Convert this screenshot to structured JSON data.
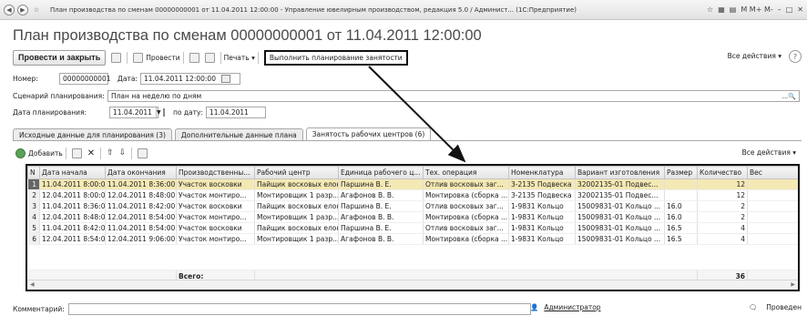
{
  "window": {
    "title": "План производства по сменам 00000000001 от 11.04.2011 12:00:00 - Управление ювелирным производством, редакция 5.0 / Админист... (1С:Предприятие)",
    "right_icons": "M  M+  M-"
  },
  "document": {
    "title": "План производства по сменам 00000000001 от 11.04.2011 12:00:00"
  },
  "toolbar": {
    "post_close": "Провести и закрыть",
    "post": "Провести",
    "print": "Печать ▾",
    "plan": "Выполнить планирование занятости",
    "all_actions": "Все действия ▾",
    "help": "?"
  },
  "form": {
    "number_label": "Номер:",
    "number_value": "00000000001",
    "date_label": "Дата:",
    "date_value": "11.04.2011 12:00:00",
    "scenario_label": "Сценарий планирования:",
    "scenario_value": "План на неделю по дням",
    "plan_date_label": "Дата планирования:",
    "plan_date_from": "11.04.2011",
    "plan_date_to_label": "по дату:",
    "plan_date_to": "11.04.2011"
  },
  "tabs": [
    {
      "label": "Исходные данные для планирования (3)"
    },
    {
      "label": "Дополнительные данные плана"
    },
    {
      "label": "Занятость рабочих центров (6)"
    }
  ],
  "table_toolbar": {
    "add": "Добавить",
    "all_actions": "Все действия ▾"
  },
  "table": {
    "columns": [
      "N",
      "Дата начала",
      "Дата окончания",
      "Производственны...",
      "Рабочий центр",
      "Единица рабочего ц...",
      "Тех. операция",
      "Номенклатура",
      "Вариант изготовления",
      "Размер",
      "Количество",
      "Вес"
    ],
    "rows": [
      [
        "1",
        "11.04.2011 8:00:00",
        "11.04.2011 8:36:00",
        "Участок восковки",
        "Пайщик восковых елок",
        "Паршина В. Е.",
        "Отлив восковых заг...",
        "3-2135 Подвеска",
        "32002135-01 Подвес...",
        "",
        "12",
        ""
      ],
      [
        "2",
        "12.04.2011 8:00:00",
        "12.04.2011 8:48:00",
        "Участок монтиро...",
        "Монтировщик 1 разр...",
        "Агафонов В. В.",
        "Монтировка (сборка ...",
        "3-2135 Подвеска",
        "32002135-01 Подвес...",
        "",
        "12",
        ""
      ],
      [
        "3",
        "11.04.2011 8:36:00",
        "11.04.2011 8:42:00",
        "Участок восковки",
        "Пайщик восковых елок",
        "Паршина В. Е.",
        "Отлив восковых заг...",
        "1-9831 Кольцо",
        "15009831-01 Кольцо ...",
        "16.0",
        "2",
        ""
      ],
      [
        "4",
        "12.04.2011 8:48:00",
        "12.04.2011 8:54:00",
        "Участок монтиро...",
        "Монтировщик 1 разр...",
        "Агафонов В. В.",
        "Монтировка (сборка ...",
        "1-9831 Кольцо",
        "15009831-01 Кольцо ...",
        "16.0",
        "2",
        ""
      ],
      [
        "5",
        "11.04.2011 8:42:00",
        "11.04.2011 8:54:00",
        "Участок восковки",
        "Пайщик восковых елок",
        "Паршина В. Е.",
        "Отлив восковых заг...",
        "1-9831 Кольцо",
        "15009831-01 Кольцо ...",
        "16.5",
        "4",
        ""
      ],
      [
        "6",
        "12.04.2011 8:54:00",
        "12.04.2011 9:06:00",
        "Участок монтиро...",
        "Монтировщик 1 разр...",
        "Агафонов В. В.",
        "Монтировка (сборка ...",
        "1-9831 Кольцо",
        "15009831-01 Кольцо ...",
        "16.5",
        "4",
        ""
      ]
    ],
    "total_label": "Всего:",
    "total_value": "36"
  },
  "footer": {
    "comment_label": "Комментарий:",
    "user": "Администратор",
    "status": "Проведен"
  },
  "colors": {
    "selected_row": "#f4e8b4",
    "highlight_border": "#111111"
  }
}
